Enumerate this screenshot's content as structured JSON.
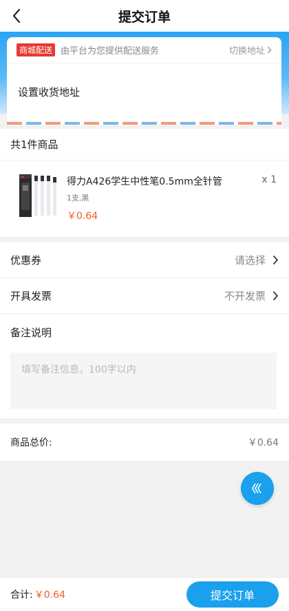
{
  "header": {
    "title": "提交订单"
  },
  "address": {
    "badge": "商城配送",
    "provider": "由平台为您提供配送服务",
    "switch_label": "切换地址",
    "set_label": "设置收货地址"
  },
  "goods": {
    "count_label": "共1件商品",
    "items": [
      {
        "name": "得力A426学生中性笔0.5mm全针管",
        "spec": "1支,黑",
        "price": "￥0.64",
        "qty": "x 1"
      }
    ]
  },
  "options": {
    "coupon": {
      "label": "优惠券",
      "value": "请选择"
    },
    "invoice": {
      "label": "开具发票",
      "value": "不开发票"
    },
    "remark": {
      "label": "备注说明",
      "placeholder": "填写备注信息，100字以内"
    }
  },
  "total": {
    "label": "商品总价:",
    "value": "￥0.64"
  },
  "bottom": {
    "sum_label": "合计:",
    "sum_value": "￥0.64",
    "submit_label": "提交订单"
  },
  "colors": {
    "accent": "#1aa0ec",
    "price": "#f25a22",
    "badge": "#e53a32"
  },
  "icons": {
    "back": "chevron-left-icon",
    "arrow": "chevron-right-icon",
    "float": "triple-chevron-left-icon"
  }
}
